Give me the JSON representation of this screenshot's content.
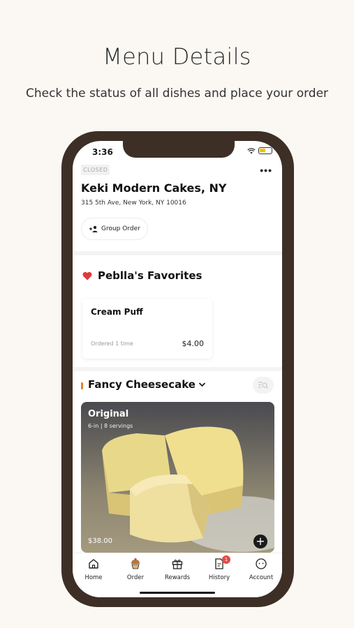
{
  "promo": {
    "headline": "Menu Details",
    "subline": "Check the status of all dishes and place your order"
  },
  "status_bar": {
    "time": "3:36"
  },
  "store": {
    "status_tag": "CLOSED",
    "name": "Keki Modern Cakes, NY",
    "address": "315 5th Ave, New York, NY 10016",
    "group_order_label": "Group Order"
  },
  "favorites": {
    "title": "Peblla's Favorites",
    "items": [
      {
        "name": "Cream Puff",
        "ordered": "Ordered 1 time",
        "price": "$4.00"
      }
    ]
  },
  "category": {
    "title": "Fancy Cheesecake",
    "accent_color": "#e0822f",
    "items": [
      {
        "name": "Original",
        "description": "6-in | 8 servings",
        "price": "$38.00"
      }
    ]
  },
  "tabbar": {
    "tabs": [
      {
        "label": "Home",
        "icon": "home-icon"
      },
      {
        "label": "Order",
        "icon": "cupcake-icon"
      },
      {
        "label": "Rewards",
        "icon": "gift-icon"
      },
      {
        "label": "History",
        "icon": "receipt-icon",
        "badge": "1"
      },
      {
        "label": "Account",
        "icon": "account-icon"
      }
    ]
  },
  "colors": {
    "phone_frame": "#3d2f26",
    "heart": "#e03a3a",
    "badge": "#e34a4a"
  }
}
